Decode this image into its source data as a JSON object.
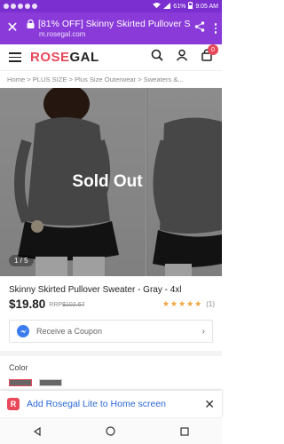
{
  "statusbar": {
    "battery": "61%",
    "time": "9:05 AM"
  },
  "browser": {
    "tab_title": "[81% OFF] Skinny Skirted Pullover S...",
    "url": "m.rosegal.com"
  },
  "site": {
    "logo_brand": "ROSE",
    "logo_rest": "GAL",
    "cart_count": "0"
  },
  "breadcrumb": {
    "items": [
      "Home",
      "PLUS SIZE",
      "Plus Size Outerwear",
      "Sweaters &..."
    ]
  },
  "gallery": {
    "overlay_text": "Sold Out",
    "pager": "1 / 5"
  },
  "product": {
    "title": "Skinny Skirted Pullover Sweater - Gray - 4xl",
    "price": "$19.80",
    "rrp_label": "RRP",
    "rrp_value": "$102.67",
    "rating_stars": 5,
    "review_count": "(1)"
  },
  "coupon": {
    "label": "Receive a Coupon"
  },
  "options": {
    "color_label": "Color"
  },
  "install_banner": {
    "text": "Add Rosegal Lite to Home screen"
  },
  "colors": {
    "browser_purple": "#8a3ad8",
    "brand_red": "#e8485a",
    "star_gold": "#f2a33a",
    "link_blue": "#2a67d6"
  }
}
